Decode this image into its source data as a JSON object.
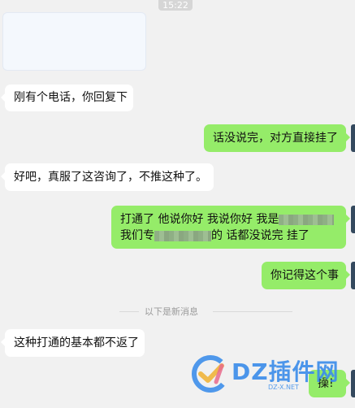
{
  "chat": {
    "time": "15:22",
    "order_card": {
      "title": "",
      "fields": [
        {
          "label": "",
          "value": ""
        },
        {
          "label": "",
          "value": ""
        },
        {
          "label": "",
          "value": ""
        },
        {
          "label": "",
          "value": ""
        },
        {
          "label": "",
          "value": ""
        },
        {
          "label": "",
          "value": ""
        }
      ]
    },
    "messages": [
      {
        "side": "left",
        "text": "刚有个电话，你回复下"
      },
      {
        "side": "right",
        "text": "话没说完，对方直接挂了"
      },
      {
        "side": "left",
        "text": "好吧，真服了这咨询了，不推这种了。"
      },
      {
        "side": "right",
        "line1_a": "打通了 他说你好  我说你好 我是",
        "line2_a": "我们专",
        "line2_b": "的 话都没说完 挂了"
      },
      {
        "side": "right",
        "text": "你记得这个事"
      },
      {
        "side": "left",
        "text": "这种打通的基本都不返了"
      },
      {
        "side": "right",
        "text": "操!"
      }
    ],
    "new_messages_divider": "以下是新消息"
  },
  "watermark": {
    "brand": "DZ插件网",
    "url": "DZ-X.NET",
    "brand_color": "#3d8eea",
    "icon": "dz-logo-icon"
  },
  "colors": {
    "background": "#f1f1f1",
    "incoming_bubble": "#ffffff",
    "outgoing_bubble": "#95ec69"
  }
}
